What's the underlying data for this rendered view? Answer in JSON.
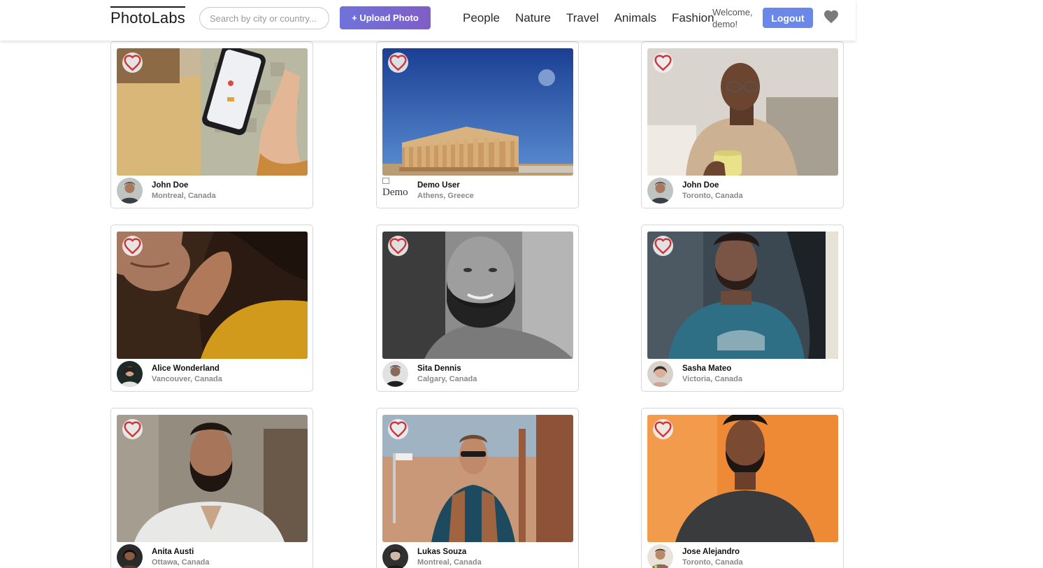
{
  "app": {
    "logo": "PhotoLabs"
  },
  "search": {
    "placeholder": "Search by city or country..."
  },
  "upload_label": "+ Upload Photo",
  "topics": [
    "People",
    "Nature",
    "Travel",
    "Animals",
    "Fashion"
  ],
  "user": {
    "welcome": "Welcome, demo!",
    "logout_label": "Logout"
  },
  "colors": {
    "accent": "#6f73db",
    "logout": "#6a88e8",
    "like_heart": "#d0343a",
    "nav_heart": "#7a7a7a"
  },
  "photos": [
    {
      "name": "John Doe",
      "location": "Montreal, Canada",
      "image": "hand-holding-phone",
      "liked": false
    },
    {
      "name": "Demo User",
      "location": "Athens, Greece",
      "image": "parthenon",
      "liked": false,
      "avatar_alt": "Demo"
    },
    {
      "name": "John Doe",
      "location": "Toronto, Canada",
      "image": "man-with-mug",
      "liked": false
    },
    {
      "name": "Alice Wonderland",
      "location": "Vancouver, Canada",
      "image": "woman-curly-hair",
      "liked": false
    },
    {
      "name": "Sita Dennis",
      "location": "Calgary, Canada",
      "image": "bearded-man-bw",
      "liked": false
    },
    {
      "name": "Sasha Mateo",
      "location": "Victoria, Canada",
      "image": "man-blue-shirt",
      "liked": false
    },
    {
      "name": "Anita Austi",
      "location": "Ottawa, Canada",
      "image": "bearded-man-white-shirt",
      "liked": false
    },
    {
      "name": "Lukas Souza",
      "location": "Montreal, Canada",
      "image": "man-sunglasses-vest",
      "liked": false
    },
    {
      "name": "Jose Alejandro",
      "location": "Toronto, Canada",
      "image": "man-orange-background",
      "liked": false
    }
  ]
}
